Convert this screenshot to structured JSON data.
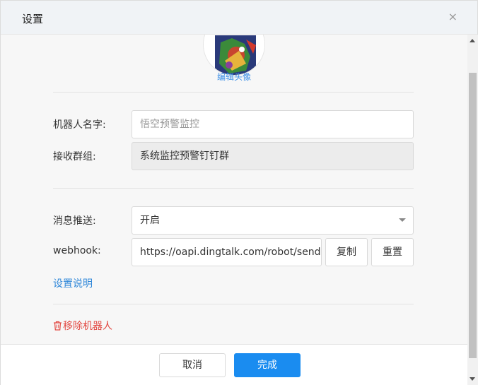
{
  "dialog": {
    "title": "设置",
    "close_glyph": "×"
  },
  "avatar": {
    "edit_label": "编辑头像"
  },
  "form": {
    "robot_name_label": "机器人名字:",
    "robot_name_placeholder": "悟空预警监控",
    "receive_group_label": "接收群组:",
    "receive_group_value": "系统监控预警钉钉群",
    "push_label": "消息推送:",
    "push_value": "开启",
    "webhook_label": "webhook:",
    "webhook_value": "https://oapi.dingtalk.com/robot/send",
    "copy_label": "复制",
    "reset_label": "重置",
    "help_link": "设置说明",
    "remove_label": "移除机器人"
  },
  "footer": {
    "cancel_label": "取消",
    "confirm_label": "完成"
  },
  "colors": {
    "primary": "#1a8cf0",
    "link": "#2f87d9",
    "danger": "#e2463f"
  },
  "icons": [
    "close-icon",
    "trash-icon",
    "chevron-down-icon"
  ]
}
